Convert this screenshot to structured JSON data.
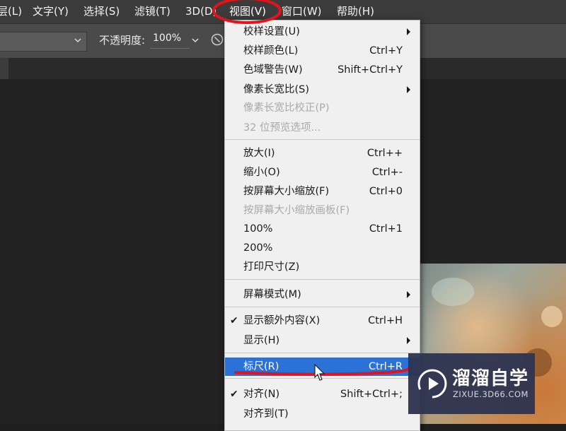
{
  "menubar": {
    "items": [
      {
        "label": "层(L)"
      },
      {
        "label": "文字(Y)"
      },
      {
        "label": "选择(S)"
      },
      {
        "label": "滤镜(T)"
      },
      {
        "label": "3D(D)"
      },
      {
        "label": "视图(V)"
      },
      {
        "label": "窗口(W)"
      },
      {
        "label": "帮助(H)"
      }
    ],
    "active": "视图(V)"
  },
  "options_bar": {
    "opacity_label": "不透明度:",
    "opacity_value": "100%",
    "icons": [
      "chevron-down-icon",
      "chevron-down-icon",
      "clear-icon"
    ]
  },
  "view_menu": {
    "items": [
      {
        "label": "校样设置(U)",
        "shortcut": "",
        "submenu": true,
        "disabled": false,
        "checked": false
      },
      {
        "label": "校样颜色(L)",
        "shortcut": "Ctrl+Y",
        "submenu": false,
        "disabled": false,
        "checked": false
      },
      {
        "label": "色域警告(W)",
        "shortcut": "Shift+Ctrl+Y",
        "submenu": false,
        "disabled": false,
        "checked": false
      },
      {
        "label": "像素长宽比(S)",
        "shortcut": "",
        "submenu": true,
        "disabled": false,
        "checked": false
      },
      {
        "label": "像素长宽比校正(P)",
        "shortcut": "",
        "submenu": false,
        "disabled": true,
        "checked": false
      },
      {
        "label": "32 位预览选项...",
        "shortcut": "",
        "submenu": false,
        "disabled": true,
        "checked": false
      },
      {
        "label": "放大(I)",
        "shortcut": "Ctrl++",
        "submenu": false,
        "disabled": false,
        "checked": false
      },
      {
        "label": "缩小(O)",
        "shortcut": "Ctrl+-",
        "submenu": false,
        "disabled": false,
        "checked": false
      },
      {
        "label": "按屏幕大小缩放(F)",
        "shortcut": "Ctrl+0",
        "submenu": false,
        "disabled": false,
        "checked": false
      },
      {
        "label": "按屏幕大小缩放画板(F)",
        "shortcut": "",
        "submenu": false,
        "disabled": true,
        "checked": false
      },
      {
        "label": "100%",
        "shortcut": "Ctrl+1",
        "submenu": false,
        "disabled": false,
        "checked": false
      },
      {
        "label": "200%",
        "shortcut": "",
        "submenu": false,
        "disabled": false,
        "checked": false
      },
      {
        "label": "打印尺寸(Z)",
        "shortcut": "",
        "submenu": false,
        "disabled": false,
        "checked": false
      },
      {
        "label": "屏幕模式(M)",
        "shortcut": "",
        "submenu": true,
        "disabled": false,
        "checked": false
      },
      {
        "label": "显示额外内容(X)",
        "shortcut": "Ctrl+H",
        "submenu": false,
        "disabled": false,
        "checked": true
      },
      {
        "label": "显示(H)",
        "shortcut": "",
        "submenu": true,
        "disabled": false,
        "checked": false
      },
      {
        "label": "标尺(R)",
        "shortcut": "Ctrl+R",
        "submenu": false,
        "disabled": false,
        "checked": false,
        "highlighted": true
      },
      {
        "label": "对齐(N)",
        "shortcut": "Shift+Ctrl+;",
        "submenu": false,
        "disabled": false,
        "checked": true
      },
      {
        "label": "对齐到(T)",
        "shortcut": "",
        "submenu": false,
        "disabled": false,
        "checked": false
      }
    ]
  },
  "watermark": {
    "title": "溜溜自学",
    "subtitle": "ZIXUE.3D66.COM"
  },
  "colors": {
    "menubar_bg": "#3b3b3b",
    "menu_bg": "#f0f0f0",
    "highlight": "#2c71d6",
    "annotation_red": "#e0141e"
  }
}
